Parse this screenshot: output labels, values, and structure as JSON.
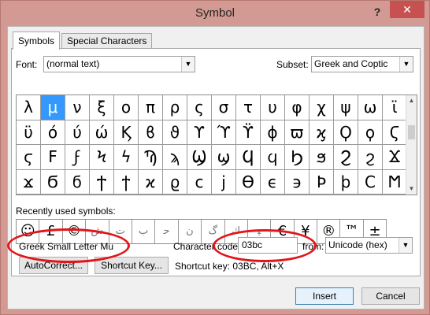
{
  "window": {
    "title": "Symbol",
    "help_label": "?",
    "close_label": "✕"
  },
  "tabs": [
    {
      "label": "Symbols",
      "active": true
    },
    {
      "label": "Special Characters",
      "active": false
    }
  ],
  "font": {
    "label": "Font:",
    "value": "(normal text)"
  },
  "subset": {
    "label": "Subset:",
    "value": "Greek and Coptic"
  },
  "symbol_grid": [
    [
      "λ",
      "μ",
      "ν",
      "ξ",
      "ο",
      "π",
      "ρ",
      "ς",
      "σ",
      "τ",
      "υ",
      "φ",
      "χ",
      "ψ",
      "ω",
      "ϊ"
    ],
    [
      "ϋ",
      "ό",
      "ύ",
      "ώ",
      "Ϗ",
      "ϐ",
      "ϑ",
      "ϒ",
      "ϓ",
      "ϔ",
      "ϕ",
      "ϖ",
      "ϗ",
      "Ϙ",
      "ϙ",
      "Ϛ"
    ],
    [
      "ϛ",
      "Ϝ",
      "ϝ",
      "Ϟ",
      "ϟ",
      "Ϡ",
      "ϡ",
      "Ϣ",
      "ϣ",
      "Ϥ",
      "ϥ",
      "Ϧ",
      "ϧ",
      "Ϩ",
      "ϩ",
      "Ϫ"
    ],
    [
      "ϫ",
      "Ϭ",
      "ϭ",
      "Ϯ",
      "ϯ",
      "ϰ",
      "ϱ",
      "ϲ",
      "ϳ",
      "ϴ",
      "ϵ",
      "϶",
      "Ϸ",
      "ϸ",
      "Ϲ",
      "Ϻ"
    ]
  ],
  "selected_symbol": "μ",
  "recent": {
    "label": "Recently used symbols:",
    "symbols": [
      "☺",
      "£",
      "©",
      "ش",
      "ت",
      "ﺏ",
      "ﺣ",
      "ن",
      "ﮒ",
      "ﻙ",
      "ﯿ",
      "€",
      "¥",
      "®",
      "™",
      "±"
    ]
  },
  "character_name": "Greek Small Letter Mu",
  "character_code": {
    "label": "Character code:",
    "value": "03bc"
  },
  "from": {
    "label": "from:",
    "value": "Unicode (hex)"
  },
  "buttons": {
    "autocorrect": "AutoCorrect...",
    "shortcut_key": "Shortcut Key...",
    "insert": "Insert",
    "cancel": "Cancel"
  },
  "shortcut_text": "Shortcut key: 03BC, Alt+X",
  "highlight_color": "#e0161a"
}
